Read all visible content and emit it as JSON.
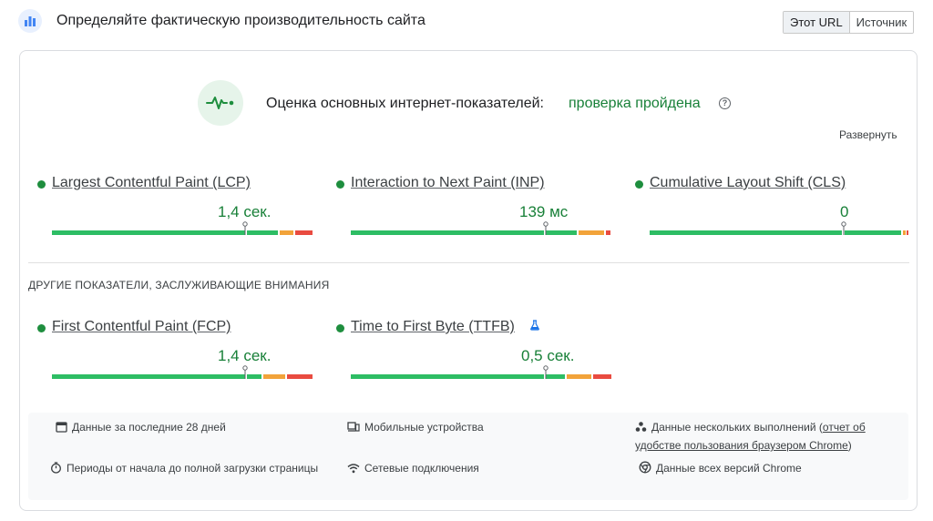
{
  "header": {
    "title": "Определяйте фактическую производительность сайта",
    "app_icon": "bar-chart-icon",
    "toggle": [
      "Этот URL",
      "Источник"
    ]
  },
  "assessment": {
    "title": "Оценка основных интернет-показателей:",
    "status": "проверка пройдена",
    "status_color": "#188038",
    "expand_label": "Развернуть"
  },
  "core_metrics": [
    {
      "name": "Largest Contentful Paint (LCP)",
      "value": "1,4 сек."
    },
    {
      "name": "Interaction to Next Paint (INP)",
      "value": "139 мс"
    },
    {
      "name": "Cumulative Layout Shift (CLS)",
      "value": "0"
    }
  ],
  "other_section_label": "ДРУГИЕ ПОКАЗАТЕЛИ, ЗАСЛУЖИВАЮЩИЕ ВНИМАНИЯ",
  "other_metrics": [
    {
      "name": "First Contentful Paint (FCP)",
      "value": "1,4 сек."
    },
    {
      "name": "Time to First Byte (TTFB)",
      "value": "0,5 сек.",
      "icon": "flask-icon"
    }
  ],
  "info": {
    "period": "Данные за последние 28 дней",
    "devices": "Мобильные устройства",
    "samples_prefix": "Данные нескольких выполнений (",
    "samples_link": "отчет об удобстве пользования браузером Chrome",
    "samples_suffix": ")",
    "duration": "Периоды от начала до полной загрузки страницы",
    "network": "Сетевые подключения",
    "versions": "Данные всех версий Chrome"
  },
  "colors": {
    "good": "#2dbd64",
    "needs_improvement": "#f2a33a",
    "poor": "#e94b40"
  }
}
